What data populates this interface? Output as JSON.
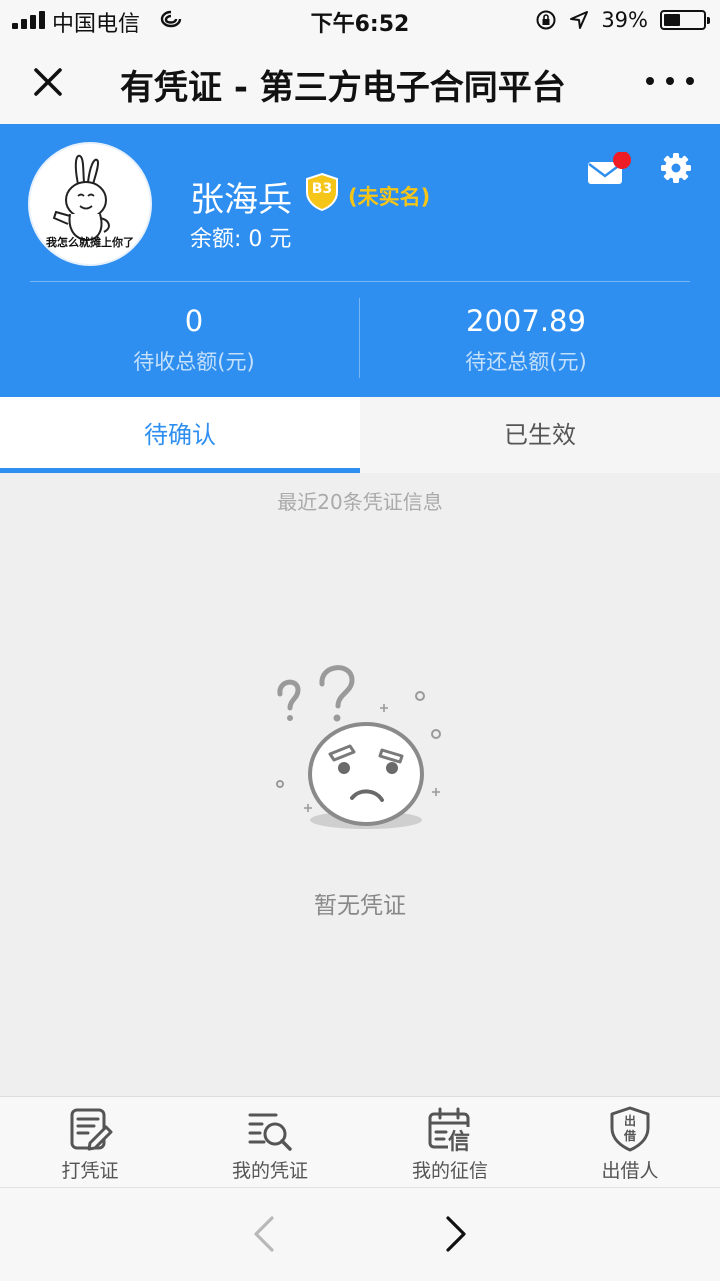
{
  "status_bar": {
    "carrier": "中国电信",
    "time": "下午6:52",
    "battery": "39%",
    "battery_level": 0.39
  },
  "navbar": {
    "title": "有凭证 - 第三方电子合同平台",
    "icons": [
      "close-icon",
      "more-icon"
    ]
  },
  "profile": {
    "name": "张海兵",
    "level_badge": "B3",
    "verification": "(未实名)",
    "balance": "余额: 0 元",
    "avatar_caption": "我怎么就摊上你了",
    "accent_color": "#2f8ff0",
    "notification_dot_color": "#ee1c25"
  },
  "stats": [
    {
      "value": "0",
      "label": "待收总额(元)"
    },
    {
      "value": "2007.89",
      "label": "待还总额(元)"
    }
  ],
  "tabs": [
    {
      "label": "待确认",
      "active": true
    },
    {
      "label": "已生效",
      "active": false
    }
  ],
  "list_hint": "最近20条凭证信息",
  "empty_state": "暂无凭证",
  "bottom_tabs": [
    {
      "label": "打凭证",
      "icon": "write-voucher-icon"
    },
    {
      "label": "我的凭证",
      "icon": "list-search-icon"
    },
    {
      "label": "我的征信",
      "icon": "credit-icon",
      "icon_text": "信"
    },
    {
      "label": "出借人",
      "icon": "lender-shield-icon",
      "icon_text": [
        "出",
        "借"
      ]
    }
  ]
}
